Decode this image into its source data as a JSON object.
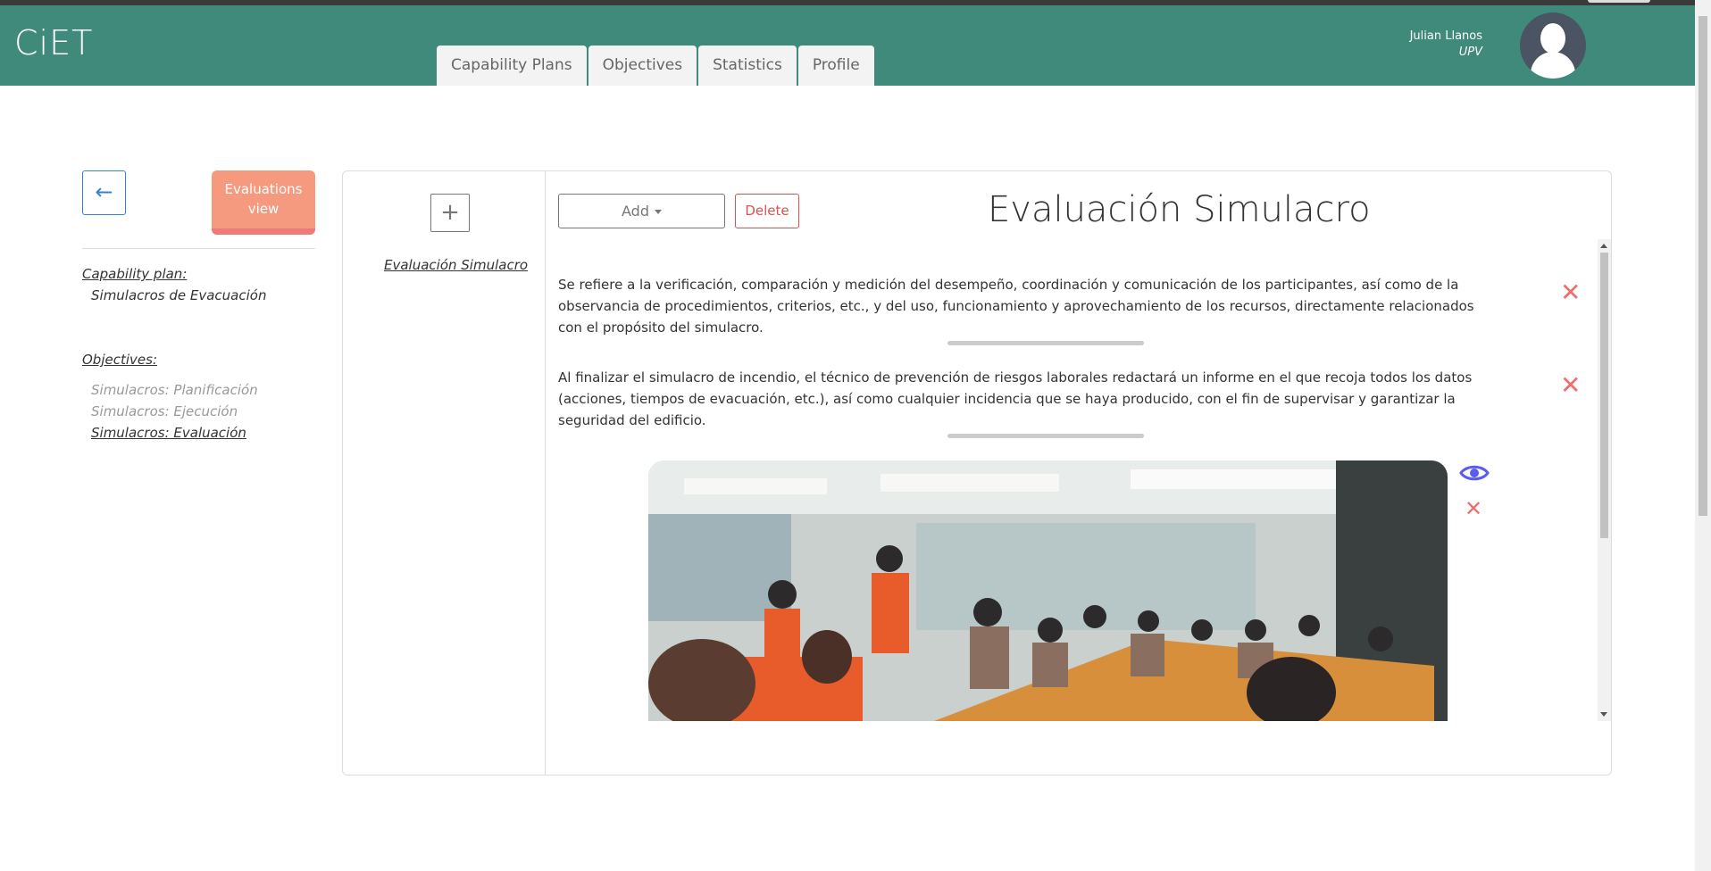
{
  "app": {
    "brand": "CiET"
  },
  "nav": {
    "tabs": [
      {
        "label": "Capability Plans"
      },
      {
        "label": "Objectives"
      },
      {
        "label": "Statistics"
      },
      {
        "label": "Profile"
      }
    ]
  },
  "user": {
    "name": "Julian Llanos",
    "org": "UPV"
  },
  "left": {
    "back_icon": "←",
    "evaluations_view_label": "Evaluations view",
    "capability_plan_heading": "Capability plan:",
    "capability_plan_value": "Simulacros de Evacuación",
    "objectives_heading": "Objectives:",
    "objectives": [
      {
        "label": "Simulacros: Planificación"
      },
      {
        "label": "Simulacros: Ejecución"
      },
      {
        "label": "Simulacros: Evaluación"
      }
    ]
  },
  "card": {
    "plus_icon": "+",
    "evaluation_link": "Evaluación Simulacro",
    "add_label": "Add",
    "delete_label": "Delete",
    "title": "Evaluación Simulacro",
    "entries": [
      {
        "text": "Se refiere a la verificación, comparación y medición del desempeño, coordinación y comunicación de los participantes, así como de la observancia de procedimientos, criterios, etc., y del uso, funcionamiento y aprovechamiento de los recursos, directamente relacionados con el propósito del simulacro."
      },
      {
        "text": "Al finalizar el simulacro de incendio, el técnico de prevención de riesgos laborales redactará un informe en el que recoja todos los datos (acciones, tiempos de evacuación, etc.), así como cualquier incidencia que se haya producido, con el fin de supervisar y garantizar la seguridad del edificio."
      }
    ],
    "remove_icon": "✕"
  },
  "colors": {
    "header": "#408a7c",
    "accent_blue": "#3b82c4",
    "evaluations_button": "#f59a7e",
    "danger": "#d9534f",
    "remove_icon": "#ee6e6e",
    "eye_icon": "#5b5bf0"
  },
  "icons": [
    "arrow-left-icon",
    "plus-icon",
    "caret-down-icon",
    "close-icon",
    "eye-icon",
    "user-avatar-icon"
  ]
}
